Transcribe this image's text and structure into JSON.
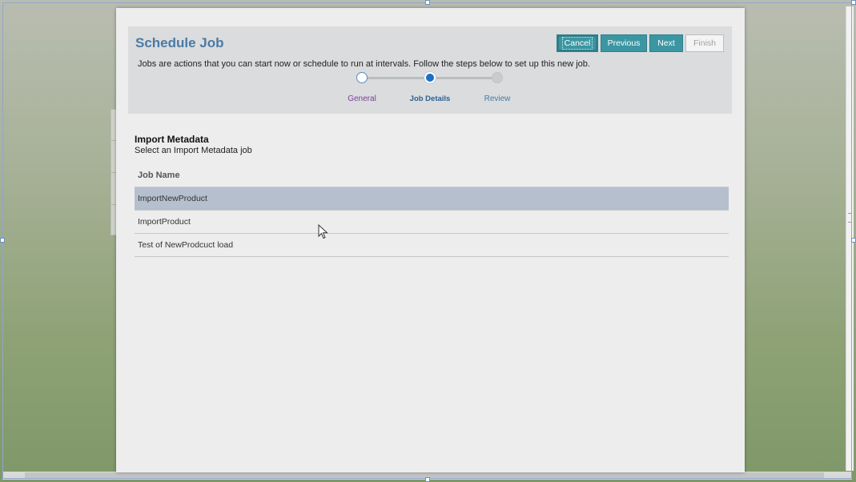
{
  "dialog": {
    "title": "Schedule Job",
    "description": "Jobs are actions that you can start now or schedule to run at intervals. Follow the steps below to set up this new job.",
    "buttons": {
      "cancel": "Cancel",
      "previous": "Previous",
      "next": "Next",
      "finish": "Finish"
    },
    "steps": [
      {
        "label": "General",
        "state": "visited"
      },
      {
        "label": "Job Details",
        "state": "current"
      },
      {
        "label": "Review",
        "state": "unvisited"
      }
    ]
  },
  "section": {
    "title": "Import Metadata",
    "subtitle": "Select an Import Metadata job"
  },
  "table": {
    "column_header": "Job Name",
    "rows": [
      {
        "name": "ImportNewProduct",
        "selected": true
      },
      {
        "name": "ImportProduct",
        "selected": false
      },
      {
        "name": "Test of NewProdcuct load",
        "selected": false
      }
    ]
  },
  "colors": {
    "accent": "#3b96a2",
    "title": "#4a7aa5",
    "selected_row": "#b5bfcd",
    "current_step": "#1c6fc6"
  },
  "icons": {
    "pointer": "mouse-pointer-icon"
  }
}
